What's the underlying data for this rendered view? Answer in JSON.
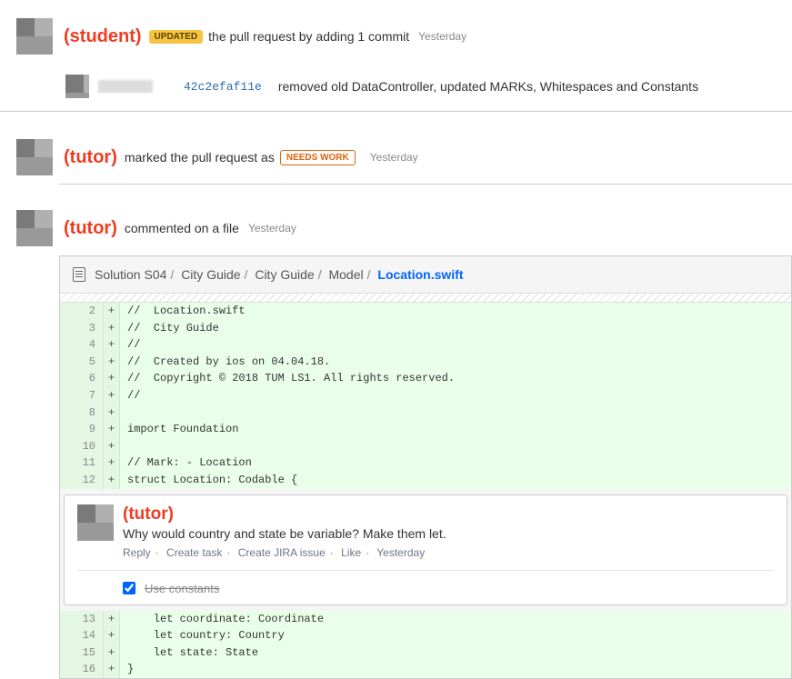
{
  "roles": {
    "student": "(student)",
    "tutor": "(tutor)"
  },
  "activity": {
    "updated": {
      "badge": "UPDATED",
      "text": "the pull request by adding 1 commit",
      "when": "Yesterday"
    },
    "commit": {
      "hash": "42c2efaf11e",
      "msg": "removed old DataController, updated MARKs, Whitespaces and Constants"
    },
    "needswork": {
      "text": "marked the pull request as",
      "badge": "NEEDS WORK",
      "when": "Yesterday"
    },
    "commented": {
      "text": "commented on a file",
      "when": "Yesterday"
    }
  },
  "file": {
    "path_parts": [
      "Solution S04",
      "City Guide",
      "City Guide",
      "Model"
    ],
    "name": "Location.swift"
  },
  "code_lines_top": [
    {
      "n": "2",
      "s": "+",
      "t": "//  Location.swift"
    },
    {
      "n": "3",
      "s": "+",
      "t": "//  City Guide"
    },
    {
      "n": "4",
      "s": "+",
      "t": "//"
    },
    {
      "n": "5",
      "s": "+",
      "t": "//  Created by ios on 04.04.18."
    },
    {
      "n": "6",
      "s": "+",
      "t": "//  Copyright © 2018 TUM LS1. All rights reserved."
    },
    {
      "n": "7",
      "s": "+",
      "t": "//"
    },
    {
      "n": "8",
      "s": "+",
      "t": ""
    },
    {
      "n": "9",
      "s": "+",
      "t": "import Foundation"
    },
    {
      "n": "10",
      "s": "+",
      "t": ""
    },
    {
      "n": "11",
      "s": "+",
      "t": "// Mark: - Location"
    },
    {
      "n": "12",
      "s": "+",
      "t": "struct Location: Codable {"
    }
  ],
  "inline_comment": {
    "body": "Why would country and state be variable? Make them let.",
    "actions": {
      "reply": "Reply",
      "task": "Create task",
      "jira": "Create JIRA issue",
      "like": "Like",
      "when": "Yesterday"
    },
    "task_text": "Use constants",
    "task_done": true
  },
  "code_lines_bottom": [
    {
      "n": "13",
      "s": "+",
      "t": "    let coordinate: Coordinate"
    },
    {
      "n": "14",
      "s": "+",
      "t": "    let country: Country"
    },
    {
      "n": "15",
      "s": "+",
      "t": "    let state: State"
    },
    {
      "n": "16",
      "s": "+",
      "t": "}"
    }
  ]
}
